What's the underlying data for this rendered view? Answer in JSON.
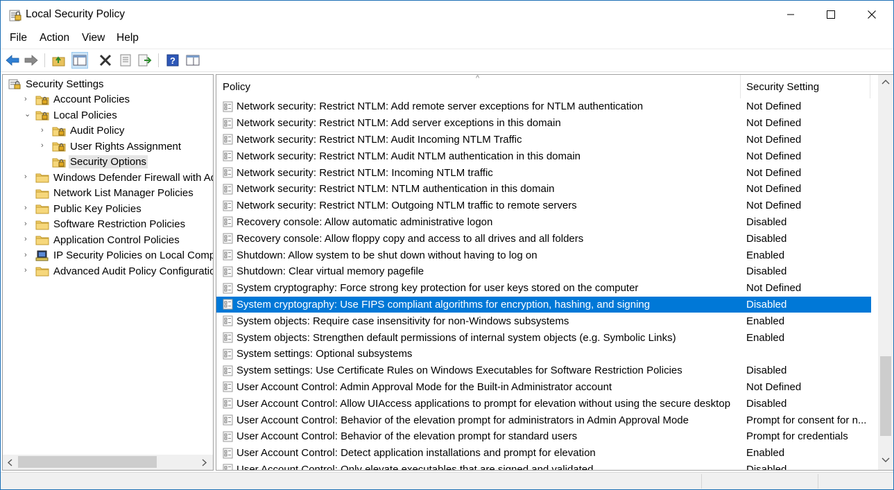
{
  "window": {
    "title": "Local Security Policy",
    "controls": {
      "minimize": "─",
      "maximize": "☐",
      "close": "✕"
    }
  },
  "menu": [
    "File",
    "Action",
    "View",
    "Help"
  ],
  "toolbar": {
    "buttons": [
      "back-icon",
      "forward-icon",
      "up-folder-icon",
      "show-hide-tree-icon",
      "delete-icon",
      "properties-icon",
      "export-list-icon",
      "help-icon",
      "show-console-icon"
    ]
  },
  "tree": [
    {
      "label": "Security Settings",
      "expander": "",
      "level": 0
    },
    {
      "label": "Account Policies",
      "expander": "›",
      "level": 1
    },
    {
      "label": "Local Policies",
      "expander": "⌄",
      "level": 1
    },
    {
      "label": "Audit Policy",
      "expander": "›",
      "level": 2
    },
    {
      "label": "User Rights Assignment",
      "expander": "›",
      "level": 2
    },
    {
      "label": "Security Options",
      "expander": "",
      "level": 2,
      "selected": true
    },
    {
      "label": "Windows Defender Firewall with Advanced Security",
      "expander": "›",
      "level": 1
    },
    {
      "label": "Network List Manager Policies",
      "expander": "",
      "level": 1
    },
    {
      "label": "Public Key Policies",
      "expander": "›",
      "level": 1
    },
    {
      "label": "Software Restriction Policies",
      "expander": "›",
      "level": 1
    },
    {
      "label": "Application Control Policies",
      "expander": "›",
      "level": 1
    },
    {
      "label": "IP Security Policies on Local Computer",
      "expander": "›",
      "level": 1
    },
    {
      "label": "Advanced Audit Policy Configuration",
      "expander": "›",
      "level": 1
    }
  ],
  "list": {
    "columns": {
      "policy": "Policy",
      "setting": "Security Setting"
    },
    "sort_indicator": "^",
    "rows": [
      {
        "policy": "Network security: Restrict NTLM: Add remote server exceptions for NTLM authentication",
        "setting": "Not Defined"
      },
      {
        "policy": "Network security: Restrict NTLM: Add server exceptions in this domain",
        "setting": "Not Defined"
      },
      {
        "policy": "Network security: Restrict NTLM: Audit Incoming NTLM Traffic",
        "setting": "Not Defined"
      },
      {
        "policy": "Network security: Restrict NTLM: Audit NTLM authentication in this domain",
        "setting": "Not Defined"
      },
      {
        "policy": "Network security: Restrict NTLM: Incoming NTLM traffic",
        "setting": "Not Defined"
      },
      {
        "policy": "Network security: Restrict NTLM: NTLM authentication in this domain",
        "setting": "Not Defined"
      },
      {
        "policy": "Network security: Restrict NTLM: Outgoing NTLM traffic to remote servers",
        "setting": "Not Defined"
      },
      {
        "policy": "Recovery console: Allow automatic administrative logon",
        "setting": "Disabled"
      },
      {
        "policy": "Recovery console: Allow floppy copy and access to all drives and all folders",
        "setting": "Disabled"
      },
      {
        "policy": "Shutdown: Allow system to be shut down without having to log on",
        "setting": "Enabled"
      },
      {
        "policy": "Shutdown: Clear virtual memory pagefile",
        "setting": "Disabled"
      },
      {
        "policy": "System cryptography: Force strong key protection for user keys stored on the computer",
        "setting": "Not Defined"
      },
      {
        "policy": "System cryptography: Use FIPS compliant algorithms for encryption, hashing, and signing",
        "setting": "Disabled",
        "selected": true
      },
      {
        "policy": "System objects: Require case insensitivity for non-Windows subsystems",
        "setting": "Enabled"
      },
      {
        "policy": "System objects: Strengthen default permissions of internal system objects (e.g. Symbolic Links)",
        "setting": "Enabled"
      },
      {
        "policy": "System settings: Optional subsystems",
        "setting": ""
      },
      {
        "policy": "System settings: Use Certificate Rules on Windows Executables for Software Restriction Policies",
        "setting": "Disabled"
      },
      {
        "policy": "User Account Control: Admin Approval Mode for the Built-in Administrator account",
        "setting": "Not Defined"
      },
      {
        "policy": "User Account Control: Allow UIAccess applications to prompt for elevation without using the secure desktop",
        "setting": "Disabled"
      },
      {
        "policy": "User Account Control: Behavior of the elevation prompt for administrators in Admin Approval Mode",
        "setting": "Prompt for consent for n..."
      },
      {
        "policy": "User Account Control: Behavior of the elevation prompt for standard users",
        "setting": "Prompt for credentials"
      },
      {
        "policy": "User Account Control: Detect application installations and prompt for elevation",
        "setting": "Enabled"
      },
      {
        "policy": "User Account Control: Only elevate executables that are signed and validated",
        "setting": "Disabled"
      }
    ]
  },
  "colors": {
    "selection": "#0078d7",
    "tree_selection": "#e5e5e5",
    "folder": "#e8c15c"
  }
}
